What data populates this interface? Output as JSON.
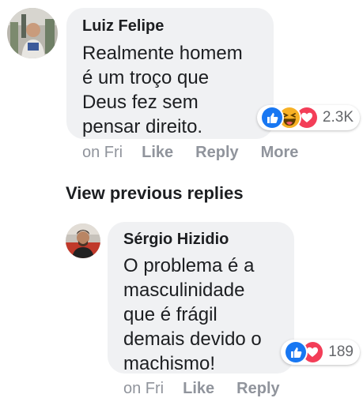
{
  "comments": [
    {
      "author": "Luiz Felipe",
      "text_lines": [
        "Realmente homem",
        "é um troço que",
        "Deus fez sem",
        "pensar direito."
      ],
      "reactions": {
        "icons": [
          "like-reaction-icon",
          "haha-reaction-icon",
          "love-reaction-icon"
        ],
        "count": "2.3K"
      },
      "timestamp": "on Fri",
      "actions": [
        "Like",
        "Reply",
        "More"
      ]
    }
  ],
  "view_previous_label": "View previous replies",
  "replies": [
    {
      "author": "Sérgio Hizidio",
      "text_lines": [
        "O problema é a",
        "masculinidade",
        "que é frágil",
        "demais devido o",
        "machismo!"
      ],
      "reactions": {
        "icons": [
          "like-reaction-icon",
          "love-reaction-icon"
        ],
        "count": "189"
      },
      "timestamp": "on Fri",
      "actions": [
        "Like",
        "Reply"
      ]
    }
  ],
  "colors": {
    "bubble": "#f0f1f3",
    "meta_text": "#90949c",
    "like_blue": "#1877f2",
    "love_red": "#f33e58",
    "haha_yellow": "#f7b125"
  }
}
